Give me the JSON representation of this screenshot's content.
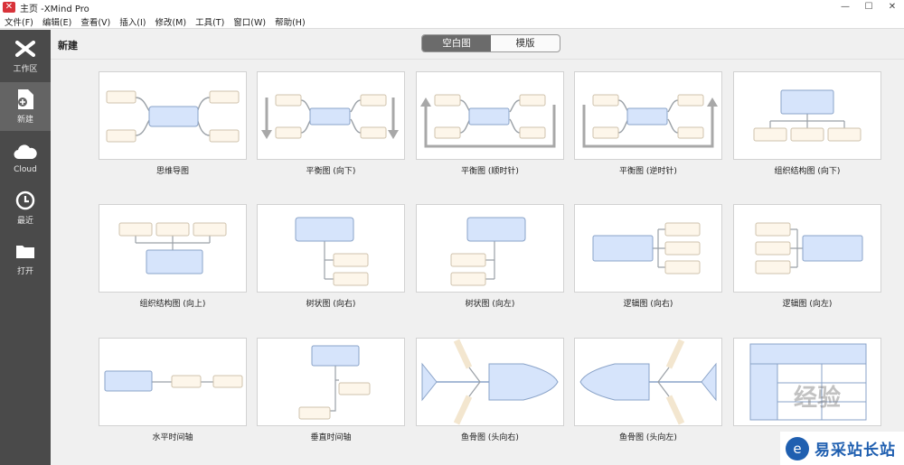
{
  "window": {
    "title": "主页 -XMind Pro",
    "controls": [
      "—",
      "☐",
      "✕"
    ]
  },
  "menu": [
    "文件(F)",
    "编辑(E)",
    "查看(V)",
    "插入(I)",
    "修改(M)",
    "工具(T)",
    "窗口(W)",
    "帮助(H)"
  ],
  "sidebar": {
    "items": [
      {
        "label": "工作区",
        "icon": "xmind-logo-icon"
      },
      {
        "label": "新建",
        "icon": "new-file-icon"
      },
      {
        "label": "Cloud",
        "icon": "cloud-icon"
      },
      {
        "label": "最近",
        "icon": "clock-icon"
      },
      {
        "label": "打开",
        "icon": "folder-icon"
      }
    ],
    "active_index": 1
  },
  "header": {
    "title": "新建",
    "tabs": [
      "空白图",
      "模版"
    ],
    "active_tab": 0
  },
  "templates": [
    {
      "label": "思维导图",
      "kind": "mindmap"
    },
    {
      "label": "平衡图 (向下)",
      "kind": "balance-down"
    },
    {
      "label": "平衡图 (顺时针)",
      "kind": "balance-cw"
    },
    {
      "label": "平衡图 (逆时针)",
      "kind": "balance-ccw"
    },
    {
      "label": "组织结构图 (向下)",
      "kind": "org-down"
    },
    {
      "label": "组织结构图 (向上)",
      "kind": "org-up"
    },
    {
      "label": "树状图 (向右)",
      "kind": "tree-right"
    },
    {
      "label": "树状图 (向左)",
      "kind": "tree-left"
    },
    {
      "label": "逻辑图 (向右)",
      "kind": "logic-right"
    },
    {
      "label": "逻辑图 (向左)",
      "kind": "logic-left"
    },
    {
      "label": "水平时间轴",
      "kind": "timeline-h"
    },
    {
      "label": "垂直时间轴",
      "kind": "timeline-v"
    },
    {
      "label": "鱼骨图 (头向右)",
      "kind": "fish-right"
    },
    {
      "label": "鱼骨图 (头向左)",
      "kind": "fish-left"
    },
    {
      "label": "矩阵图",
      "kind": "matrix"
    }
  ],
  "watermark": {
    "text": "经验",
    "badge_text": "易采站长站"
  },
  "colors": {
    "sidebar_bg": "#4a4a4a",
    "central_topic": "#d6e4fb",
    "subtopic": "#fdf6ea",
    "connector": "#9aa0a6"
  }
}
